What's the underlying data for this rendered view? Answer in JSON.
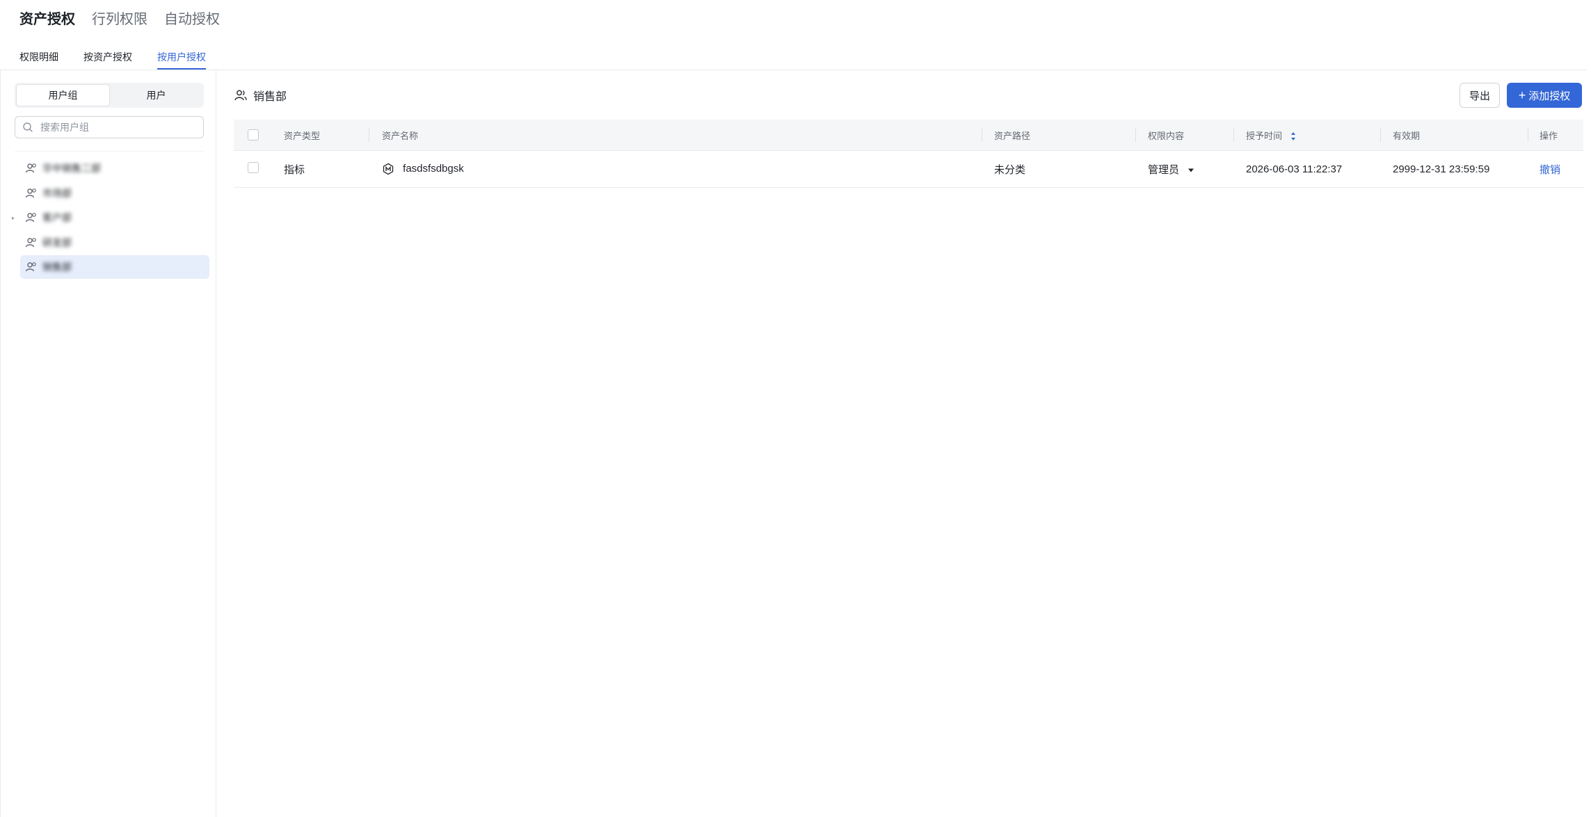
{
  "top_tabs": [
    {
      "label": "资产授权",
      "active": true
    },
    {
      "label": "行列权限",
      "active": false
    },
    {
      "label": "自动授权",
      "active": false
    }
  ],
  "sub_tabs": [
    {
      "label": "权限明细",
      "active": false
    },
    {
      "label": "按资产授权",
      "active": false
    },
    {
      "label": "按用户授权",
      "active": true
    }
  ],
  "sidebar": {
    "segment": [
      {
        "label": "用户组",
        "active": true
      },
      {
        "label": "用户",
        "active": false
      }
    ],
    "search_placeholder": "搜索用户组",
    "tree": [
      {
        "label": "华中销售二部",
        "selected": false,
        "expandable": false
      },
      {
        "label": "市场部",
        "selected": false,
        "expandable": false
      },
      {
        "label": "客户部",
        "selected": false,
        "expandable": true
      },
      {
        "label": "研发部",
        "selected": false,
        "expandable": false
      },
      {
        "label": "销售部",
        "selected": true,
        "expandable": false
      }
    ]
  },
  "main": {
    "group_name": "销售部",
    "export_label": "导出",
    "add_label": "添加授权",
    "table": {
      "headers": {
        "type": "资产类型",
        "name": "资产名称",
        "path": "资产路径",
        "permission": "权限内容",
        "grant_time": "授予时间",
        "expiry": "有效期",
        "action": "操作"
      },
      "rows": [
        {
          "type": "指标",
          "name": "fasdsfsdbgsk",
          "path": "未分类",
          "permission": "管理员",
          "grant_time": "2026-06-03 11:22:37",
          "expiry": "2999-12-31 23:59:59",
          "action": "撤销"
        }
      ]
    }
  },
  "colors": {
    "primary": "#3366d6",
    "selected_bg": "#e6edfb",
    "header_bg": "#f5f6f7"
  }
}
